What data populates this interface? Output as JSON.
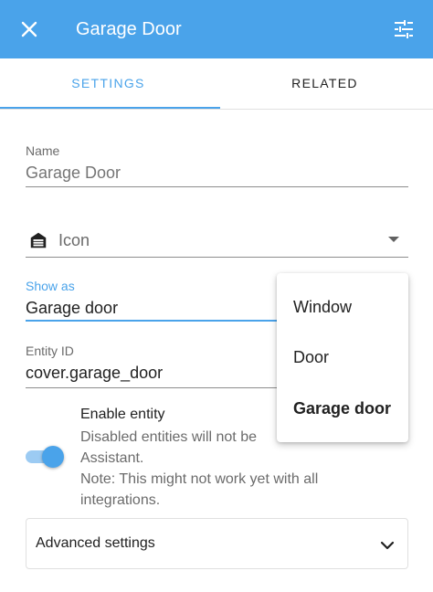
{
  "dialog": {
    "title": "Garage Door"
  },
  "tabs": [
    {
      "label": "SETTINGS"
    },
    {
      "label": "RELATED"
    }
  ],
  "form": {
    "name": {
      "label": "Name",
      "value": "Garage Door"
    },
    "icon": {
      "placeholder": "Icon"
    },
    "show_as": {
      "label": "Show as",
      "value": "Garage door",
      "options": [
        {
          "label": "Window"
        },
        {
          "label": "Door"
        },
        {
          "label": "Garage door"
        }
      ]
    },
    "entity_id": {
      "label": "Entity ID",
      "value": "cover.garage_door"
    },
    "enable_entity": {
      "label": "Enable entity",
      "description_lines": [
        "Disabled entities will not be",
        "Assistant.",
        "Note: This might not work yet with all",
        "integrations."
      ]
    },
    "advanced": {
      "label": "Advanced settings"
    }
  },
  "colors": {
    "accent": "#4aa3ea"
  },
  "icons": {
    "close": "close-icon",
    "tune": "tune-icon",
    "field_icon": "garage-icon",
    "caret": "caret-down-icon",
    "chevron": "chevron-down-icon"
  }
}
